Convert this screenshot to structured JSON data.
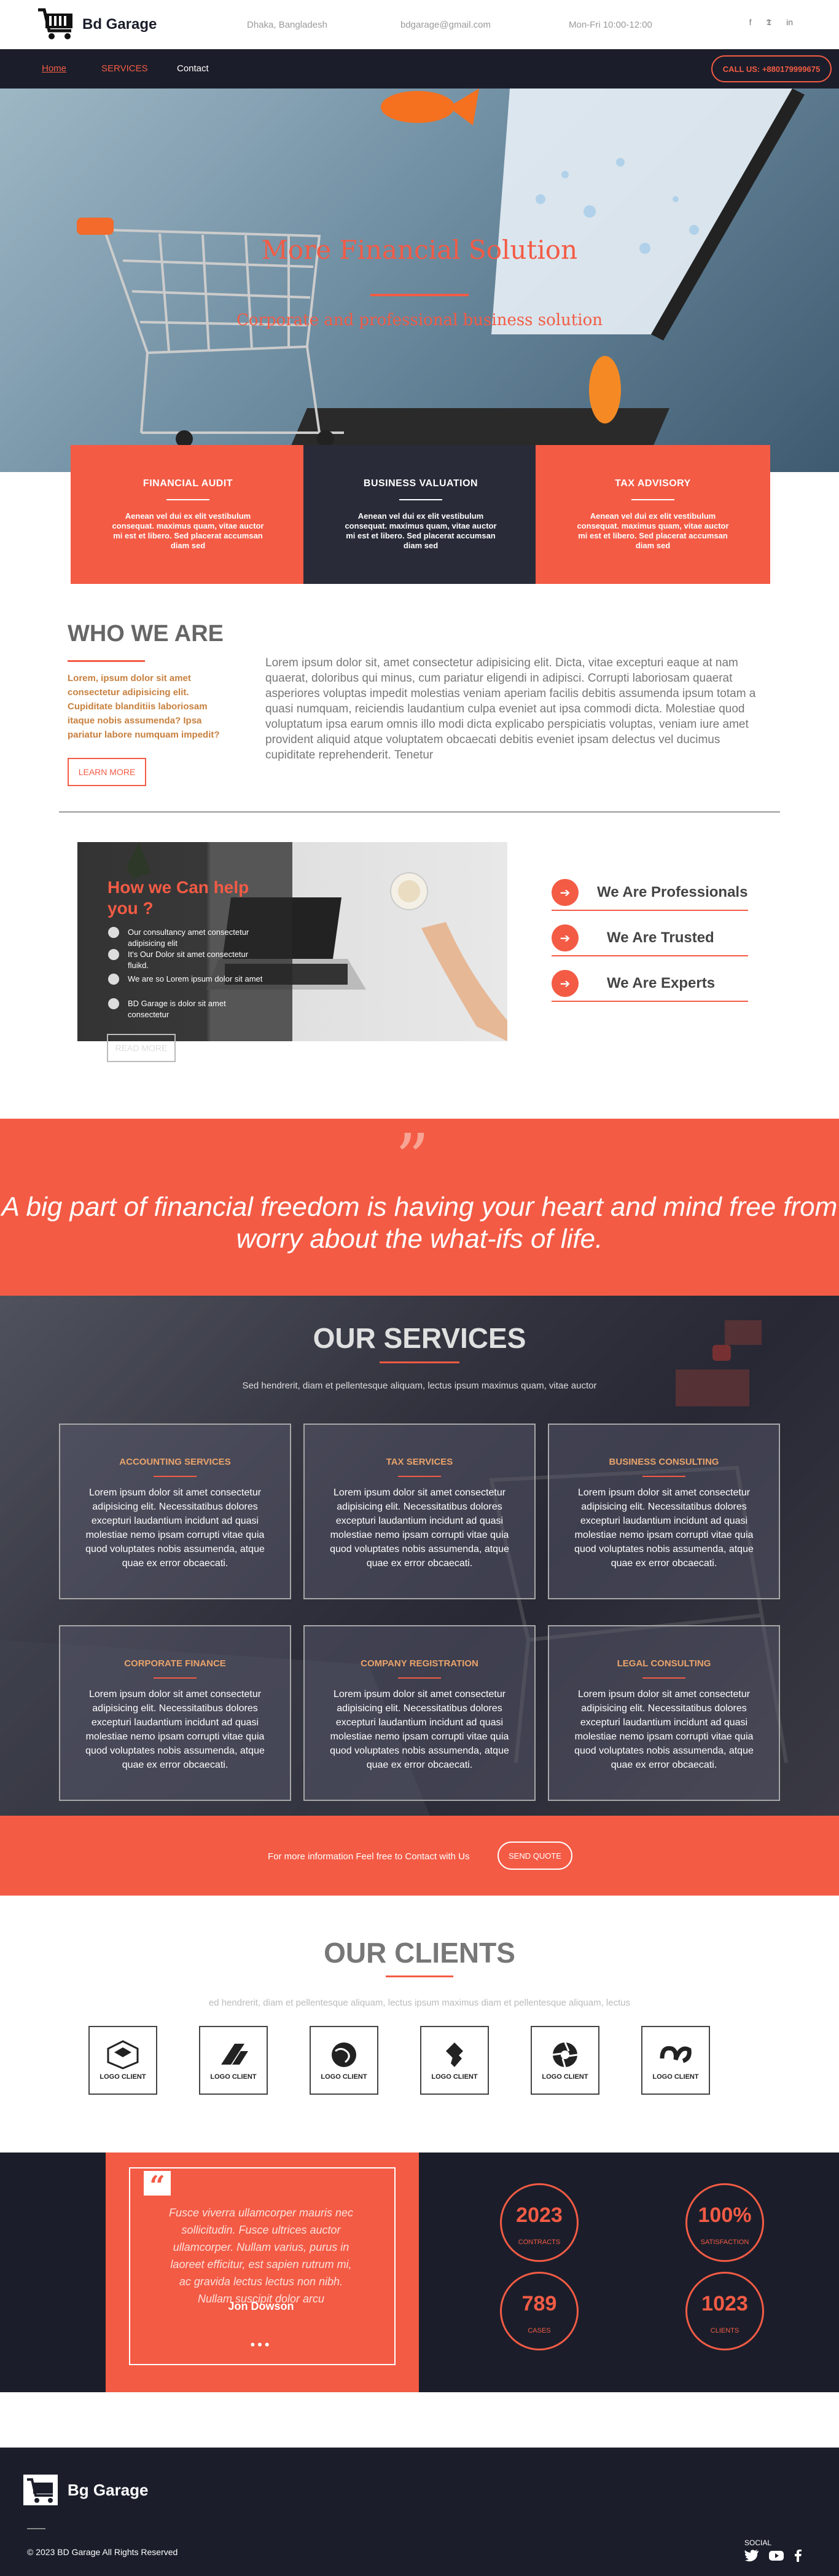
{
  "brand": {
    "name": "Bd Garage",
    "footer_name": "Bg Garage",
    "accent": "#f35b45",
    "dark": "#1b1e2a"
  },
  "topbar": {
    "location": "Dhaka, Bangladesh",
    "email": "bdgarage@gmail.com",
    "hours": "Mon-Fri 10:00-12:00",
    "social": [
      "facebook-icon",
      "twitter-icon",
      "linkedin-icon"
    ]
  },
  "nav": {
    "home": "Home",
    "services": "SERVICES",
    "contact": "Contact",
    "call": "CALL US: +880179999675"
  },
  "hero": {
    "title": "More Financial Solution",
    "subtitle": "Corporate and professional business solution"
  },
  "features": [
    {
      "title": "FINANCIAL AUDIT",
      "text": "Aenean vel dui ex elit vestibulum consequat. maximus quam, vitae auctor mi est et libero. Sed placerat accumsan diam sed"
    },
    {
      "title": "BUSINESS VALUATION",
      "text": "Aenean vel dui ex elit vestibulum consequat. maximus quam, vitae auctor mi est et libero. Sed placerat accumsan diam sed"
    },
    {
      "title": "TAX ADVISORY",
      "text": "Aenean vel dui ex elit vestibulum consequat. maximus quam, vitae auctor mi est et libero. Sed placerat accumsan diam sed"
    }
  ],
  "who": {
    "title": "WHO WE ARE",
    "side": "Lorem, ipsum dolor sit amet consectetur adipisicing elit. Cupiditate blanditiis laboriosam itaque nobis assumenda? Ipsa pariatur labore numquam impedit?",
    "button": "LEARN MORE",
    "text": "Lorem ipsum dolor sit, amet consectetur adipisicing elit. Dicta, vitae excepturi eaque at nam quaerat, doloribus qui minus, cum pariatur eligendi in adipisci. Corrupti laboriosam quaerat asperiores voluptas impedit molestias veniam aperiam facilis debitis assumenda ipsum totam a quasi numquam, reiciendis laudantium culpa eveniet aut ipsa commodi dicta. Molestiae quod voluptatum ipsa earum omnis illo modi dicta explicabo perspiciatis voluptas, veniam iure amet provident aliquid atque voluptatem obcaecati debitis eveniet ipsam delectus vel ducimus cupiditate reprehenderit. Tenetur"
  },
  "help": {
    "title": "How we Can help you ?",
    "items": [
      "Our consultancy amet consectetur adipisicing elit",
      "It's Our Dolor sit amet consectetur fluikd.",
      "We are so Lorem ipsum dolor sit amet",
      "BD Garage is dolor sit amet consectetur"
    ],
    "button": "READ MORE",
    "tags": [
      "We Are Professionals",
      "We Are Trusted",
      "We Are Experts"
    ]
  },
  "quote": {
    "text": "A big part of financial freedom is having your heart and mind free from worry about the what-ifs of life."
  },
  "services": {
    "title": "OUR SERVICES",
    "subtitle": "Sed hendrerit, diam et pellentesque aliquam, lectus ipsum maximus quam, vitae auctor",
    "items": [
      {
        "title": "ACCOUNTING SERVICES",
        "text": "Lorem ipsum dolor sit amet consectetur adipisicing elit. Necessitatibus dolores excepturi laudantium incidunt ad quasi molestiae nemo ipsam corrupti vitae quia quod voluptates nobis assumenda, atque quae ex error obcaecati."
      },
      {
        "title": "TAX SERVICES",
        "text": "Lorem ipsum dolor sit amet consectetur adipisicing elit. Necessitatibus dolores excepturi laudantium incidunt ad quasi molestiae nemo ipsam corrupti vitae quia quod voluptates nobis assumenda, atque quae ex error obcaecati."
      },
      {
        "title": "BUSINESS CONSULTING",
        "text": "Lorem ipsum dolor sit amet consectetur adipisicing elit. Necessitatibus dolores excepturi laudantium incidunt ad quasi molestiae nemo ipsam corrupti vitae quia quod voluptates nobis assumenda, atque quae ex error obcaecati."
      },
      {
        "title": "CORPORATE FINANCE",
        "text": "Lorem ipsum dolor sit amet consectetur adipisicing elit. Necessitatibus dolores excepturi laudantium incidunt ad quasi molestiae nemo ipsam corrupti vitae quia quod voluptates nobis assumenda, atque quae ex error obcaecati."
      },
      {
        "title": "COMPANY REGISTRATION",
        "text": "Lorem ipsum dolor sit amet consectetur adipisicing elit. Necessitatibus dolores excepturi laudantium incidunt ad quasi molestiae nemo ipsam corrupti vitae quia quod voluptates nobis assumenda, atque quae ex error obcaecati."
      },
      {
        "title": "LEGAL CONSULTING",
        "text": "Lorem ipsum dolor sit amet consectetur adipisicing elit. Necessitatibus dolores excepturi laudantium incidunt ad quasi molestiae nemo ipsam corrupti vitae quia quod voluptates nobis assumenda, atque quae ex error obcaecati."
      }
    ]
  },
  "cta": {
    "text": "For more information Feel free to Contact with Us",
    "button": "SEND QUOTE"
  },
  "clients": {
    "title": "OUR CLIENTS",
    "subtitle": "ed hendrerit, diam et pellentesque aliquam, lectus ipsum maximus diam et pellentesque aliquam, lectus",
    "logos": [
      "LOGO CLIENT",
      "LOGO CLIENT",
      "LOGO CLIENT",
      "LOGO CLIENT",
      "LOGO CLIENT",
      "LOGO CLIENT"
    ]
  },
  "testimonial": {
    "text": "Fusce viverra ullamcorper mauris nec sollicitudin. Fusce ultrices auctor ullamcorper. Nullam varius, purus in laoreet efficitur, est sapien rutrum mi, ac gravida lectus lectus non nibh. Nullam suscipit dolor arcu",
    "author": "Jon Dowson",
    "dots": "•••"
  },
  "stats": [
    {
      "number": "2023",
      "label": "CONTRACTS"
    },
    {
      "number": "100%",
      "label": "SATISFACTION"
    },
    {
      "number": "789",
      "label": "CASES"
    },
    {
      "number": "1023",
      "label": "CLIENTS"
    }
  ],
  "footer": {
    "copyright": "© 2023 BD Garage All Rights Reserved",
    "social_label": "SOCIAL",
    "social": [
      "twitter-icon",
      "youtube-icon",
      "facebook-icon"
    ]
  }
}
